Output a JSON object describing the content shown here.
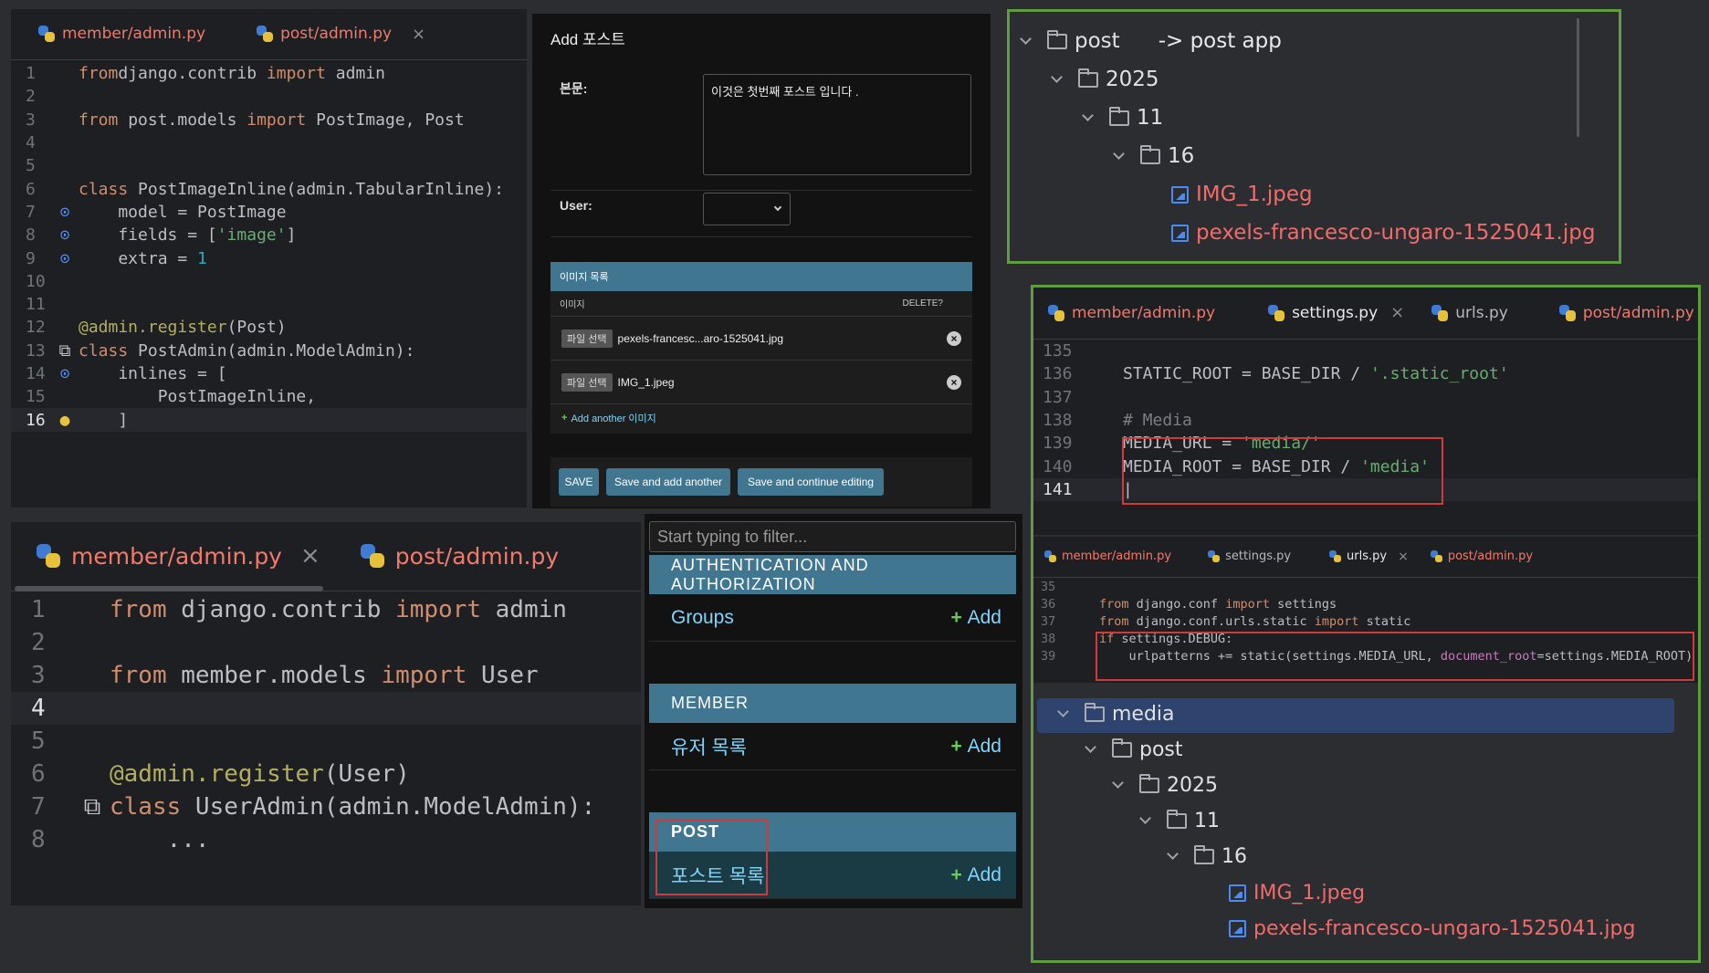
{
  "p1": {
    "tabs": [
      {
        "label": "member/admin.py",
        "active": false
      },
      {
        "label": "post/admin.py",
        "active": true
      }
    ],
    "close_glyph": "×",
    "lines": [
      {
        "n": "1",
        "parts": [
          [
            "kw",
            "from"
          ],
          [
            "",
            "django.contrib "
          ],
          [
            "kw",
            "import"
          ],
          [
            "",
            " admin"
          ]
        ]
      },
      {
        "n": "2",
        "parts": []
      },
      {
        "n": "3",
        "parts": [
          [
            "kw",
            "from"
          ],
          [
            "",
            " post.models "
          ],
          [
            "kw",
            "import"
          ],
          [
            "",
            " PostImage, Post"
          ]
        ]
      },
      {
        "n": "4",
        "parts": []
      },
      {
        "n": "5",
        "parts": []
      },
      {
        "n": "6",
        "parts": [
          [
            "kw",
            "class"
          ],
          [
            "",
            " PostImageInline(admin.TabularInline):"
          ]
        ]
      },
      {
        "n": "7",
        "parts": [
          [
            "",
            "    model = PostImage"
          ]
        ],
        "gutter": "override"
      },
      {
        "n": "8",
        "parts": [
          [
            "",
            "    fields = ["
          ],
          [
            "str",
            "'image'"
          ],
          [
            "",
            "]"
          ]
        ],
        "gutter": "override"
      },
      {
        "n": "9",
        "parts": [
          [
            "",
            "    extra = "
          ],
          [
            "numv",
            "1"
          ]
        ],
        "gutter": "override"
      },
      {
        "n": "10",
        "parts": []
      },
      {
        "n": "11",
        "parts": []
      },
      {
        "n": "12",
        "parts": [
          [
            "dec",
            "@admin.register"
          ],
          [
            "",
            "(Post)"
          ]
        ]
      },
      {
        "n": "13",
        "parts": [
          [
            "kw",
            "class"
          ],
          [
            "",
            " PostAdmin(admin.ModelAdmin):"
          ]
        ],
        "gutter": "class"
      },
      {
        "n": "14",
        "parts": [
          [
            "",
            "    inlines = ["
          ]
        ],
        "gutter": "override"
      },
      {
        "n": "15",
        "parts": [
          [
            "",
            "        PostImageInline,"
          ]
        ]
      },
      {
        "n": "16",
        "parts": [
          [
            "",
            "    ]"
          ]
        ],
        "gutter": "bulb",
        "current": true
      }
    ]
  },
  "p2": {
    "title": "Add 포스트",
    "body_label": "본문:",
    "body_value": "이것은 첫번째 포스트 입니다 .",
    "user_label": "User:",
    "user_value": "",
    "inline_title": "이미지 목록",
    "col_image": "이미지",
    "col_delete": "DELETE?",
    "rows": [
      {
        "button": "파일 선택",
        "file": "pexels-francesc...aro-1525041.jpg"
      },
      {
        "button": "파일 선택",
        "file": "IMG_1.jpeg"
      }
    ],
    "add_another": "Add another 이미지",
    "buttons": [
      "SAVE",
      "Save and add another",
      "Save and continue editing"
    ]
  },
  "p3": {
    "rows": [
      {
        "label": "post",
        "note": "-> post app"
      },
      {
        "label": "2025"
      },
      {
        "label": "11"
      },
      {
        "label": "16"
      },
      {
        "label": "IMG_1.jpeg"
      },
      {
        "label": "pexels-francesco-ungaro-1525041.jpg"
      }
    ]
  },
  "p4": {
    "tabs": [
      {
        "label": "member/admin.py",
        "active": false
      },
      {
        "label": "settings.py",
        "active": true
      },
      {
        "label": "urls.py",
        "active": false
      },
      {
        "label": "post/admin.py",
        "active": false
      }
    ],
    "close_glyph": "×",
    "lines": [
      {
        "n": "135",
        "parts": []
      },
      {
        "n": "136",
        "parts": [
          [
            "",
            "STATIC_ROOT = BASE_DIR / "
          ],
          [
            "str",
            "'.static_root'"
          ]
        ]
      },
      {
        "n": "137",
        "parts": []
      },
      {
        "n": "138",
        "parts": [
          [
            "cm",
            "# Media"
          ]
        ]
      },
      {
        "n": "139",
        "parts": [
          [
            "",
            "MEDIA_URL = "
          ],
          [
            "str",
            "'media/'"
          ]
        ]
      },
      {
        "n": "140",
        "parts": [
          [
            "",
            "MEDIA_ROOT = BASE_DIR / "
          ],
          [
            "str",
            "'media'"
          ]
        ]
      },
      {
        "n": "141",
        "parts": [
          [
            "",
            "|"
          ]
        ],
        "current": true
      }
    ]
  },
  "p5": {
    "tabs": [
      {
        "label": "member/admin.py",
        "active": false
      },
      {
        "label": "settings.py",
        "active": false
      },
      {
        "label": "urls.py",
        "active": true
      },
      {
        "label": "post/admin.py",
        "active": false
      }
    ],
    "close_glyph": "×",
    "lines": [
      {
        "n": "35",
        "parts": []
      },
      {
        "n": "36",
        "parts": [
          [
            "kw",
            "from"
          ],
          [
            "",
            " django.conf "
          ],
          [
            "kw",
            "import"
          ],
          [
            "",
            " settings"
          ]
        ]
      },
      {
        "n": "37",
        "parts": [
          [
            "kw",
            "from"
          ],
          [
            "",
            " django.conf.urls.static "
          ],
          [
            "kw",
            "import"
          ],
          [
            "",
            " static"
          ]
        ]
      },
      {
        "n": "38",
        "parts": [
          [
            "kw",
            "if"
          ],
          [
            "",
            " settings.DEBUG:"
          ]
        ]
      },
      {
        "n": "39",
        "parts": [
          [
            "",
            "    urlpatterns += static(settings.MEDIA_URL, "
          ],
          [
            "prm",
            "document_root"
          ],
          [
            "",
            "=settings.MEDIA_ROOT)"
          ]
        ]
      }
    ]
  },
  "p6": {
    "rows": [
      {
        "label": "media"
      },
      {
        "label": "post"
      },
      {
        "label": "2025"
      },
      {
        "label": "11"
      },
      {
        "label": "16"
      },
      {
        "label": "IMG_1.jpeg"
      },
      {
        "label": "pexels-francesco-ungaro-1525041.jpg"
      }
    ]
  },
  "p7": {
    "tabs": [
      {
        "label": "member/admin.py",
        "active": true
      },
      {
        "label": "post/admin.py",
        "active": false
      }
    ],
    "close_glyph": "×",
    "lines": [
      {
        "n": "1",
        "parts": [
          [
            "kw",
            "from"
          ],
          [
            "",
            " django.contrib "
          ],
          [
            "kw",
            "import"
          ],
          [
            "",
            " admin"
          ]
        ]
      },
      {
        "n": "2",
        "parts": []
      },
      {
        "n": "3",
        "parts": [
          [
            "kw",
            "from"
          ],
          [
            "",
            " member.models "
          ],
          [
            "kw",
            "import"
          ],
          [
            "",
            " User"
          ]
        ]
      },
      {
        "n": "4",
        "parts": [],
        "current": true
      },
      {
        "n": "5",
        "parts": []
      },
      {
        "n": "6",
        "parts": [
          [
            "dec",
            "@admin.register"
          ],
          [
            "",
            "(User)"
          ]
        ]
      },
      {
        "n": "7",
        "parts": [
          [
            "kw",
            "class"
          ],
          [
            "",
            " UserAdmin(admin.ModelAdmin):"
          ]
        ],
        "gutter": "class"
      },
      {
        "n": "8",
        "parts": [
          [
            "",
            "    ..."
          ]
        ]
      }
    ]
  },
  "p8": {
    "filter_placeholder": "Start typing to filter...",
    "sections": [
      {
        "title": "AUTHENTICATION AND AUTHORIZATION",
        "model": "Groups",
        "add": "Add"
      },
      {
        "title": "MEMBER",
        "model": "유저 목록",
        "add": "Add"
      },
      {
        "title": "POST",
        "model": "포스트 목록",
        "add": "Add"
      }
    ]
  }
}
